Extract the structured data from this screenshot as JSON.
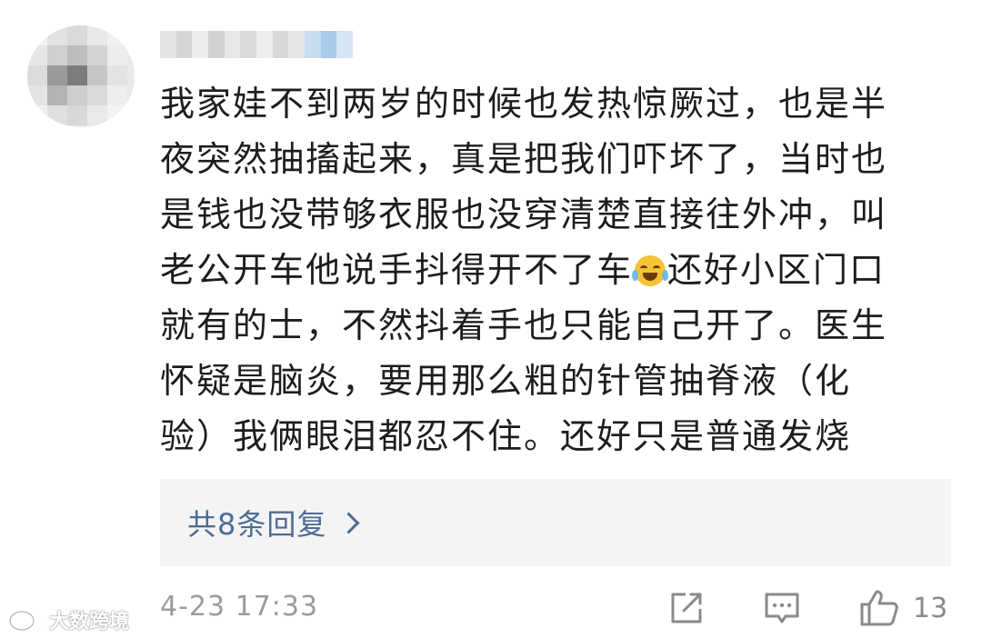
{
  "comment": {
    "username": "",
    "lines": [
      "我家娃不到两岁的时候也发热惊厥过，也是半",
      "夜突然抽搐起来，真是把我们吓坏了，当时也",
      "是钱也没带够衣服也没穿清楚直接往外冲，叫",
      "老公开车他说手抖得开不了车",
      "还好小区门口",
      "就有的士，不然抖着手也只能自己开了。医生",
      "怀疑是脑炎，要用那么粗的针管抽脊液（化",
      "验）我俩眼泪都忍不住。还好只是普通发烧"
    ],
    "emoji": "laugh-cry-emoji"
  },
  "replies": {
    "label": "共8条回复"
  },
  "footer": {
    "timestamp": "4-23 17:33",
    "share_icon": "share-icon",
    "comment_icon": "comment-icon",
    "like_icon": "thumbs-up-icon",
    "like_count": "13"
  },
  "watermark": {
    "text": "大数跨境"
  },
  "colors": {
    "text": "#1d1d1d",
    "link": "#4e6c94",
    "meta": "#9b9b9b",
    "reply_bg": "#f4f4f4"
  }
}
